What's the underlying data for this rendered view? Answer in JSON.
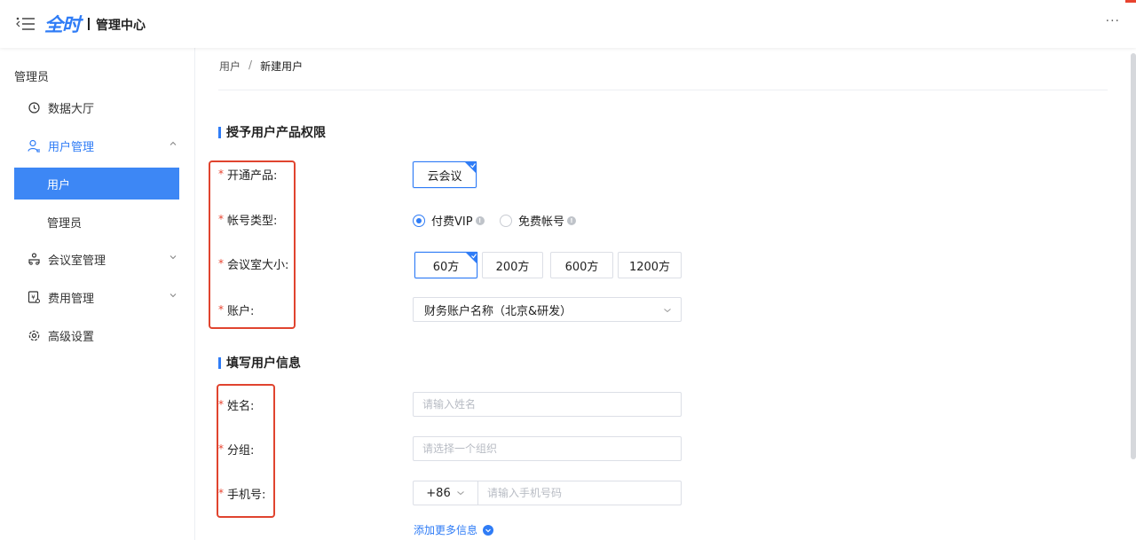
{
  "header": {
    "logo_text": "全时",
    "app_title": "管理中心",
    "more_label": "···",
    "brand_color": "#2f7cf6"
  },
  "sidebar": {
    "section_label": "管理员",
    "items": [
      {
        "label": "数据大厅",
        "icon": "clock-icon"
      },
      {
        "label": "用户管理",
        "icon": "user-manage-icon",
        "expanded": true
      },
      {
        "label": "用户",
        "selected": true
      },
      {
        "label": "管理员"
      },
      {
        "label": "会议室管理",
        "icon": "meeting-room-icon"
      },
      {
        "label": "费用管理",
        "icon": "billing-icon"
      },
      {
        "label": "高级设置",
        "icon": "settings-icon"
      }
    ],
    "selected_color": "#3d87f5"
  },
  "breadcrumb": {
    "parent": "用户",
    "separator": "/",
    "current": "新建用户"
  },
  "section_product": {
    "title": "授予用户产品权限",
    "fields": {
      "product": {
        "label": "开通产品:",
        "options": [
          "云会议"
        ],
        "selected": "云会议"
      },
      "account_type": {
        "label": "帐号类型:",
        "options": [
          {
            "label": "付费VIP",
            "checked": true
          },
          {
            "label": "免费帐号",
            "checked": false
          }
        ]
      },
      "room_size": {
        "label": "会议室大小:",
        "options": [
          "60方",
          "200方",
          "600方",
          "1200方"
        ],
        "selected": "60方"
      },
      "account": {
        "label": "账户:",
        "value": "财务账户名称（北京&研发）"
      }
    }
  },
  "section_user": {
    "title": "填写用户信息",
    "fields": {
      "name": {
        "label": "姓名:",
        "placeholder": "请输入姓名"
      },
      "group": {
        "label": "分组:",
        "placeholder": "请选择一个组织"
      },
      "phone": {
        "label": "手机号:",
        "country_code": "+86",
        "placeholder": "请输入手机号码"
      }
    },
    "add_more": "添加更多信息"
  },
  "required_mark": "*",
  "highlight_color": "#e0442f"
}
